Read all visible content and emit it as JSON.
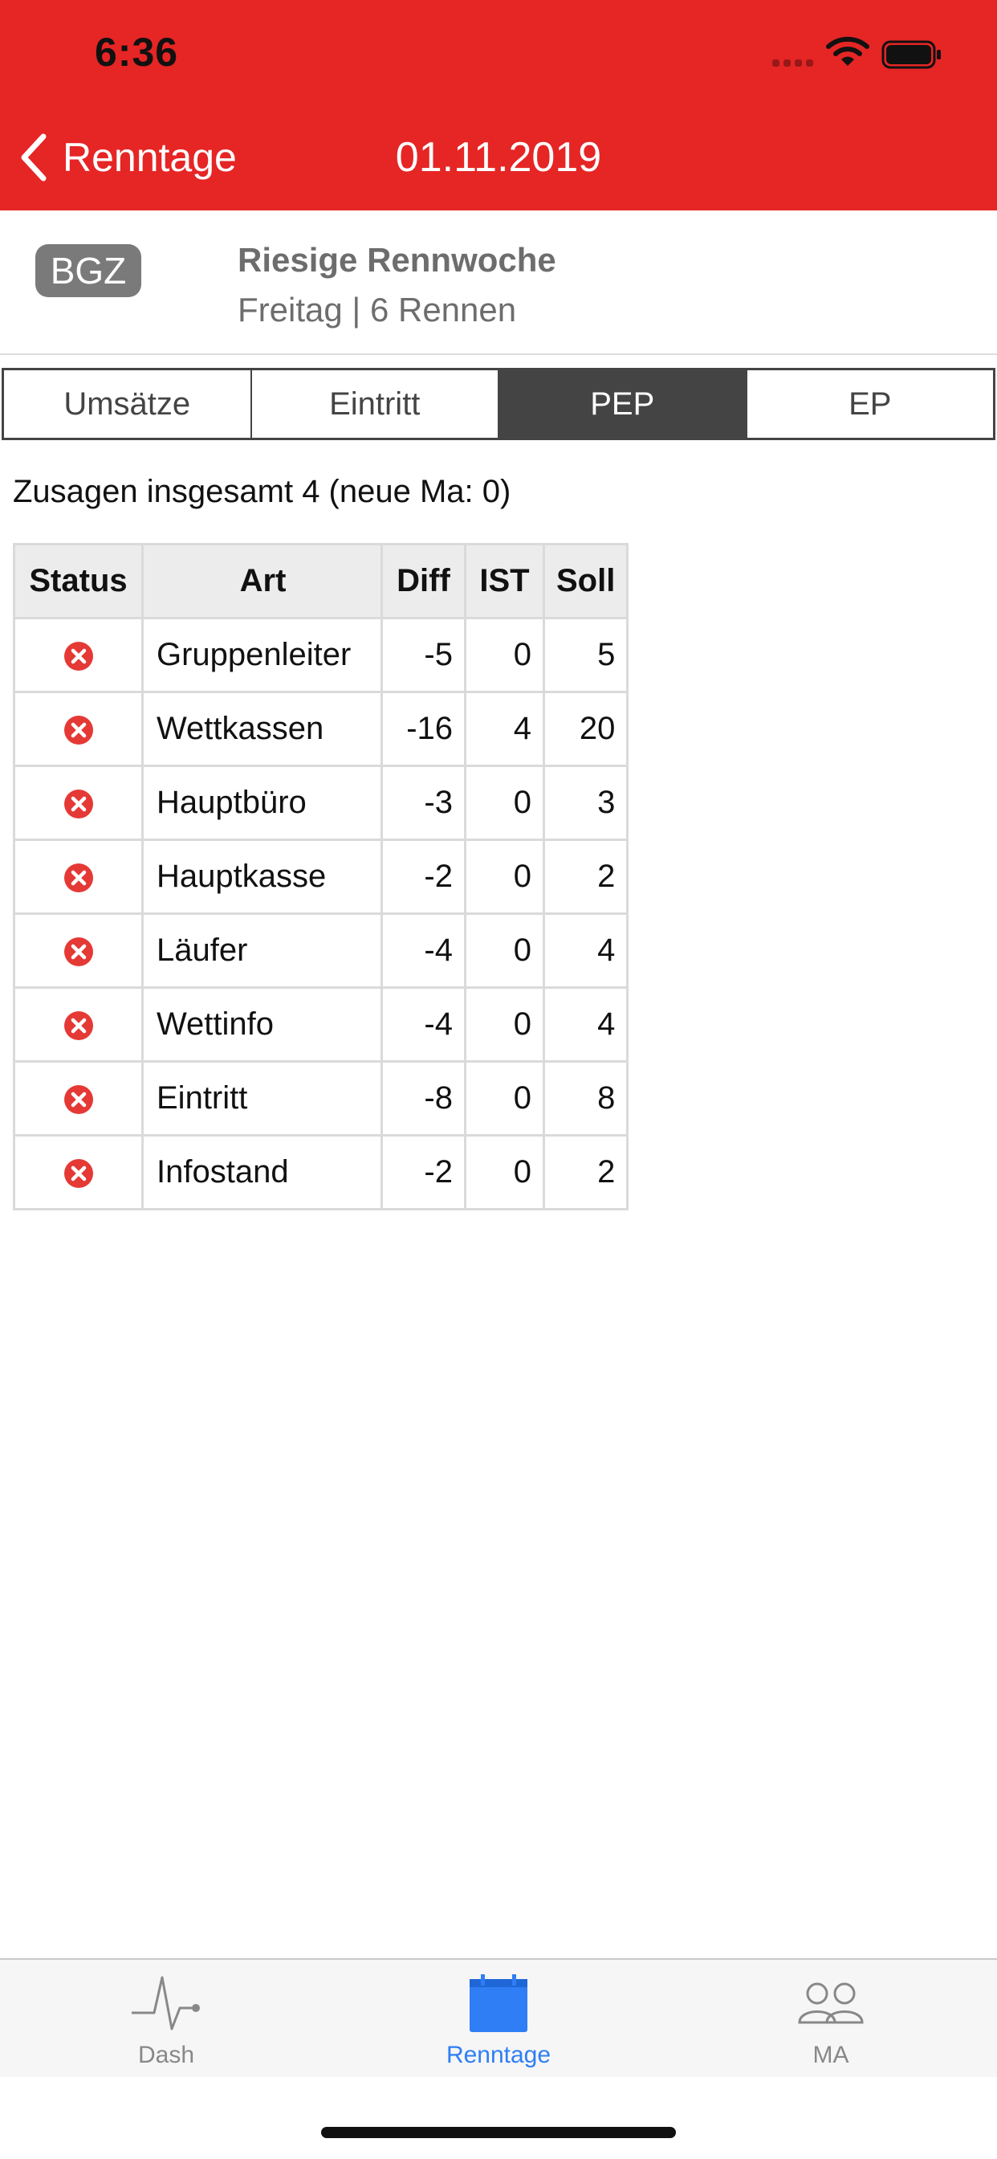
{
  "status_bar": {
    "time": "6:36"
  },
  "nav": {
    "back_label": "Renntage",
    "title": "01.11.2019"
  },
  "event": {
    "badge": "BGZ",
    "name": "Riesige Rennwoche",
    "subtitle": "Freitag | 6 Rennen"
  },
  "segments": [
    {
      "label": "Umsätze",
      "active": false
    },
    {
      "label": "Eintritt",
      "active": false
    },
    {
      "label": "PEP",
      "active": true
    },
    {
      "label": "EP",
      "active": false
    }
  ],
  "summary": "Zusagen insgesamt 4 (neue Ma: 0)",
  "table": {
    "headers": [
      "Status",
      "Art",
      "Diff",
      "IST",
      "Soll"
    ],
    "status_icon": "x-circle-icon",
    "status_color": "#e53935",
    "rows": [
      {
        "art": "Gruppenleiter",
        "diff": "-5",
        "ist": "0",
        "soll": "5"
      },
      {
        "art": "Wettkassen",
        "diff": "-16",
        "ist": "4",
        "soll": "20"
      },
      {
        "art": "Hauptbüro",
        "diff": "-3",
        "ist": "0",
        "soll": "3"
      },
      {
        "art": "Hauptkasse",
        "diff": "-2",
        "ist": "0",
        "soll": "2"
      },
      {
        "art": "Läufer",
        "diff": "-4",
        "ist": "0",
        "soll": "4"
      },
      {
        "art": "Wettinfo",
        "diff": "-4",
        "ist": "0",
        "soll": "4"
      },
      {
        "art": "Eintritt",
        "diff": "-8",
        "ist": "0",
        "soll": "8"
      },
      {
        "art": "Infostand",
        "diff": "-2",
        "ist": "0",
        "soll": "2"
      }
    ]
  },
  "tabbar": [
    {
      "label": "Dash",
      "icon": "pulse-icon",
      "active": false
    },
    {
      "label": "Renntage",
      "icon": "calendar-icon",
      "active": true
    },
    {
      "label": "MA",
      "icon": "people-icon",
      "active": false
    }
  ],
  "colors": {
    "header": "#e62525",
    "accent": "#2f7ef5",
    "segment_active": "#444444",
    "badge": "#7a7a7a"
  }
}
